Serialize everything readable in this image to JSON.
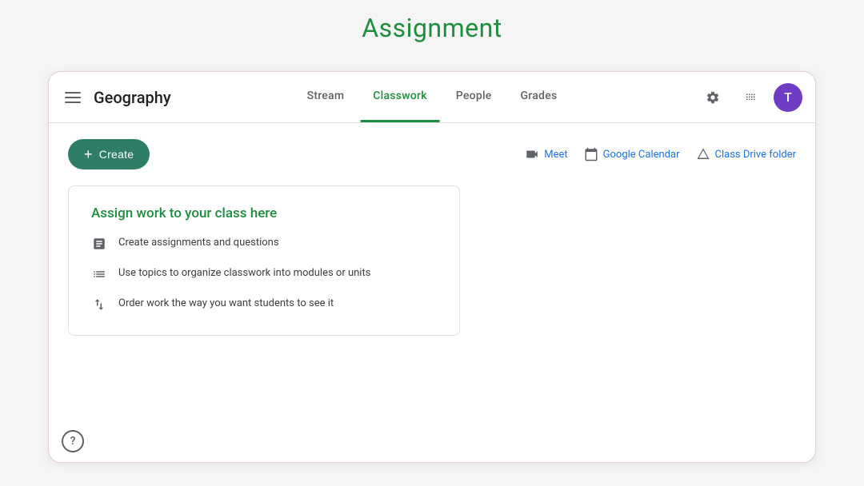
{
  "page": {
    "title": "Assignment",
    "title_color": "#1e8e3e"
  },
  "nav": {
    "class_name": "Geography",
    "tabs": [
      {
        "id": "stream",
        "label": "Stream",
        "active": false
      },
      {
        "id": "classwork",
        "label": "Classwork",
        "active": true
      },
      {
        "id": "people",
        "label": "People",
        "active": false
      },
      {
        "id": "grades",
        "label": "Grades",
        "active": false
      }
    ]
  },
  "toolbar": {
    "create_label": "Create",
    "links": [
      {
        "id": "meet",
        "label": "Meet",
        "icon": "video"
      },
      {
        "id": "calendar",
        "label": "Google Calendar",
        "icon": "calendar"
      },
      {
        "id": "drive",
        "label": "Class Drive folder",
        "icon": "drive"
      }
    ]
  },
  "classwork_card": {
    "title": "Assign work to your class here",
    "items": [
      {
        "id": "assignments",
        "text": "Create assignments and questions"
      },
      {
        "id": "topics",
        "text": "Use topics to organize classwork into modules or units"
      },
      {
        "id": "order",
        "text": "Order work the way you want students to see it"
      }
    ]
  },
  "user": {
    "avatar_letter": "T",
    "avatar_color": "#6f3cc4"
  }
}
